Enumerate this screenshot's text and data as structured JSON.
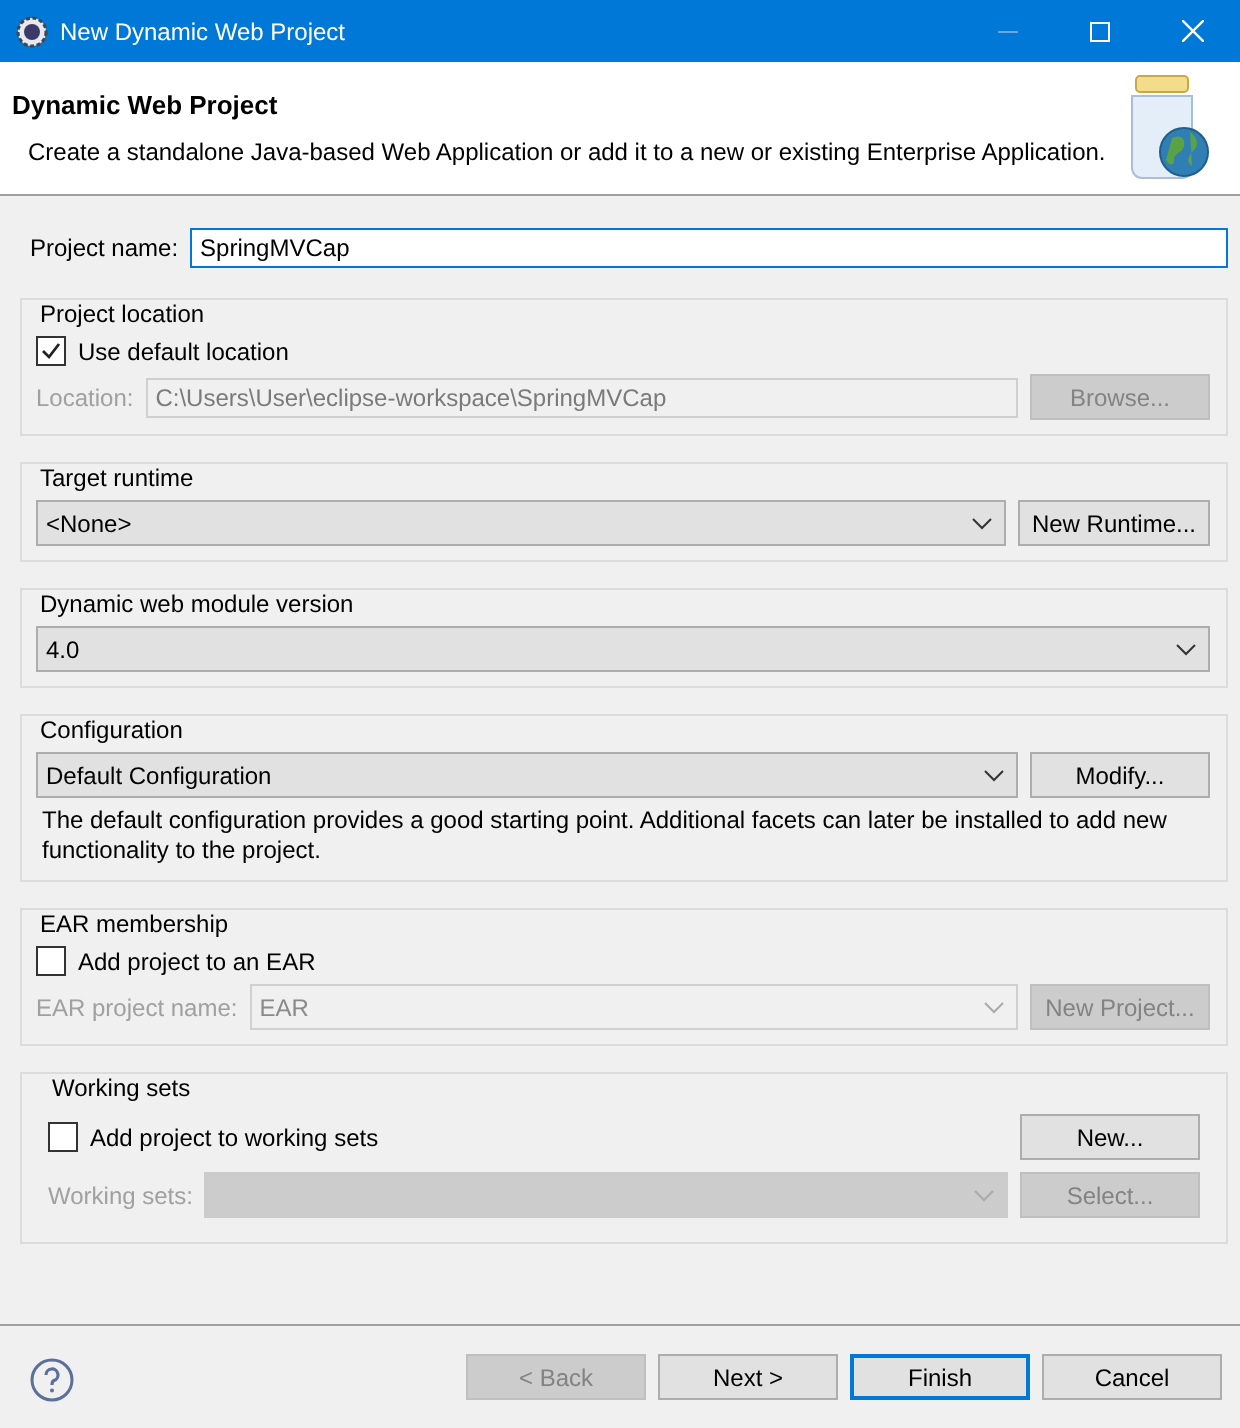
{
  "window": {
    "title": "New Dynamic Web Project"
  },
  "header": {
    "title": "Dynamic Web Project",
    "description": "Create a standalone Java-based Web Application or add it to a new or existing Enterprise Application."
  },
  "project_name": {
    "label": "Project name:",
    "value": "SpringMVCap"
  },
  "project_location": {
    "title": "Project location",
    "use_default": {
      "label": "Use default location",
      "checked": true
    },
    "location": {
      "label": "Location:",
      "value": "C:\\Users\\User\\eclipse-workspace\\SpringMVCap",
      "disabled": true
    },
    "button": {
      "label": "Browse...",
      "disabled": true
    }
  },
  "target_runtime": {
    "title": "Target runtime",
    "value": "<None>",
    "button": {
      "label": "New Runtime...",
      "disabled": false
    }
  },
  "module_version": {
    "title": "Dynamic web module version",
    "value": "4.0"
  },
  "configuration": {
    "title": "Configuration",
    "value": "Default Configuration",
    "button": {
      "label": "Modify...",
      "disabled": false
    },
    "description": "The default configuration provides a good starting point. Additional facets can later be installed to add new functionality to the project."
  },
  "ear": {
    "title": "EAR membership",
    "add": {
      "label": "Add project to an EAR",
      "checked": false
    },
    "name": {
      "label": "EAR project name:",
      "value": "EAR",
      "disabled": true
    },
    "button": {
      "label": "New Project...",
      "disabled": true
    }
  },
  "working_sets": {
    "title": "Working sets",
    "add": {
      "label": "Add project to working sets",
      "checked": false
    },
    "new_button": {
      "label": "New...",
      "disabled": false
    },
    "sets": {
      "label": "Working sets:",
      "disabled": true
    },
    "select_button": {
      "label": "Select...",
      "disabled": true
    }
  },
  "footer": {
    "buttons": [
      {
        "label": "< Back",
        "disabled": true,
        "default": false
      },
      {
        "label": "Next >",
        "disabled": false,
        "default": false
      },
      {
        "label": "Finish",
        "disabled": false,
        "default": true
      },
      {
        "label": "Cancel",
        "disabled": false,
        "default": false
      }
    ]
  }
}
